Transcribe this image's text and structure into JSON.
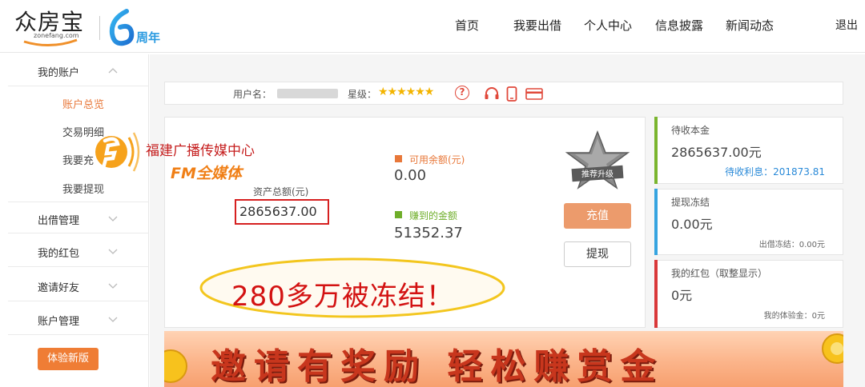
{
  "header": {
    "logo_text": "众房宝",
    "logo_sub": "zonefang.com",
    "anniversary_num": "6",
    "anniversary_text": "周年",
    "nav": [
      "首页",
      "我要出借",
      "个人中心",
      "信息披露",
      "新闻动态"
    ],
    "logout": "退出"
  },
  "sidebar": {
    "sections": [
      {
        "label": "我的账户",
        "expanded": true,
        "items": [
          {
            "label": "账户总览",
            "active": true
          },
          {
            "label": "交易明细",
            "active": false
          },
          {
            "label": "我要充",
            "active": false
          },
          {
            "label": "我要提现",
            "active": false
          }
        ]
      },
      {
        "label": "出借管理",
        "expanded": false
      },
      {
        "label": "我的红包",
        "expanded": false
      },
      {
        "label": "邀请好友",
        "expanded": false
      },
      {
        "label": "账户管理",
        "expanded": false
      }
    ],
    "trial_button": "体验新版"
  },
  "userbar": {
    "username_label": "用户名：",
    "star_label": "星级：",
    "stars": "★★★★★★",
    "help": "?",
    "icons": [
      "headset-icon",
      "mobile-icon",
      "bankcard-icon"
    ]
  },
  "assets": {
    "total_label": "资产总额(元)",
    "total_value": "2865637.00",
    "available_label": "可用余额(元)",
    "available_value": "0.00",
    "earned_label": "赚到的金额",
    "earned_value": "51352.37",
    "recharge_button": "充值",
    "withdraw_button": "提现",
    "badge_text": "推荐升级",
    "colors": {
      "available": "#e8783a",
      "earned": "#6fae2a"
    }
  },
  "cards": [
    {
      "title": "待收本金",
      "value": "2865637.00元",
      "sub": "待收利息：201873.81",
      "bar_color": "#7ab52e"
    },
    {
      "title": "提现冻结",
      "value": "0.00元",
      "sub": "出借冻结：0.00元",
      "bar_color": "#36a4e0"
    },
    {
      "title": "我的红包（取整显示）",
      "value": "0元",
      "sub": "我的体验金：0元",
      "bar_color": "#d9383a"
    }
  ],
  "overlay": {
    "watermark_title": "福建广播传媒中心",
    "watermark_fm": "FM全媒体",
    "caption": "280多万被冻结！"
  },
  "banner": {
    "text": "邀请有奖励 轻松赚赏金"
  }
}
